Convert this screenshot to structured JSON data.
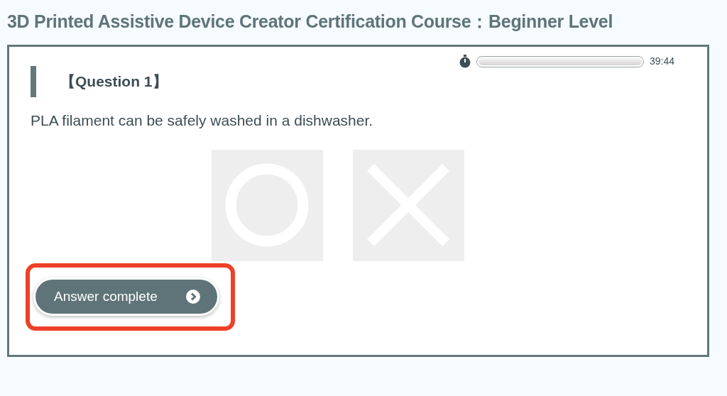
{
  "page_title": "3D Printed Assistive Device Creator Certification Course：Beginner Level",
  "timer": {
    "level": 1,
    "reading": "39:44"
  },
  "question": {
    "heading": "【Question 1】",
    "text": "PLA filament can be safely washed in a dishwasher."
  },
  "choices": [
    {
      "kind": "circle",
      "selected": false
    },
    {
      "kind": "cross",
      "selected": false
    }
  ],
  "submit_button": {
    "label": "Answer complete",
    "highlighted": true
  }
}
